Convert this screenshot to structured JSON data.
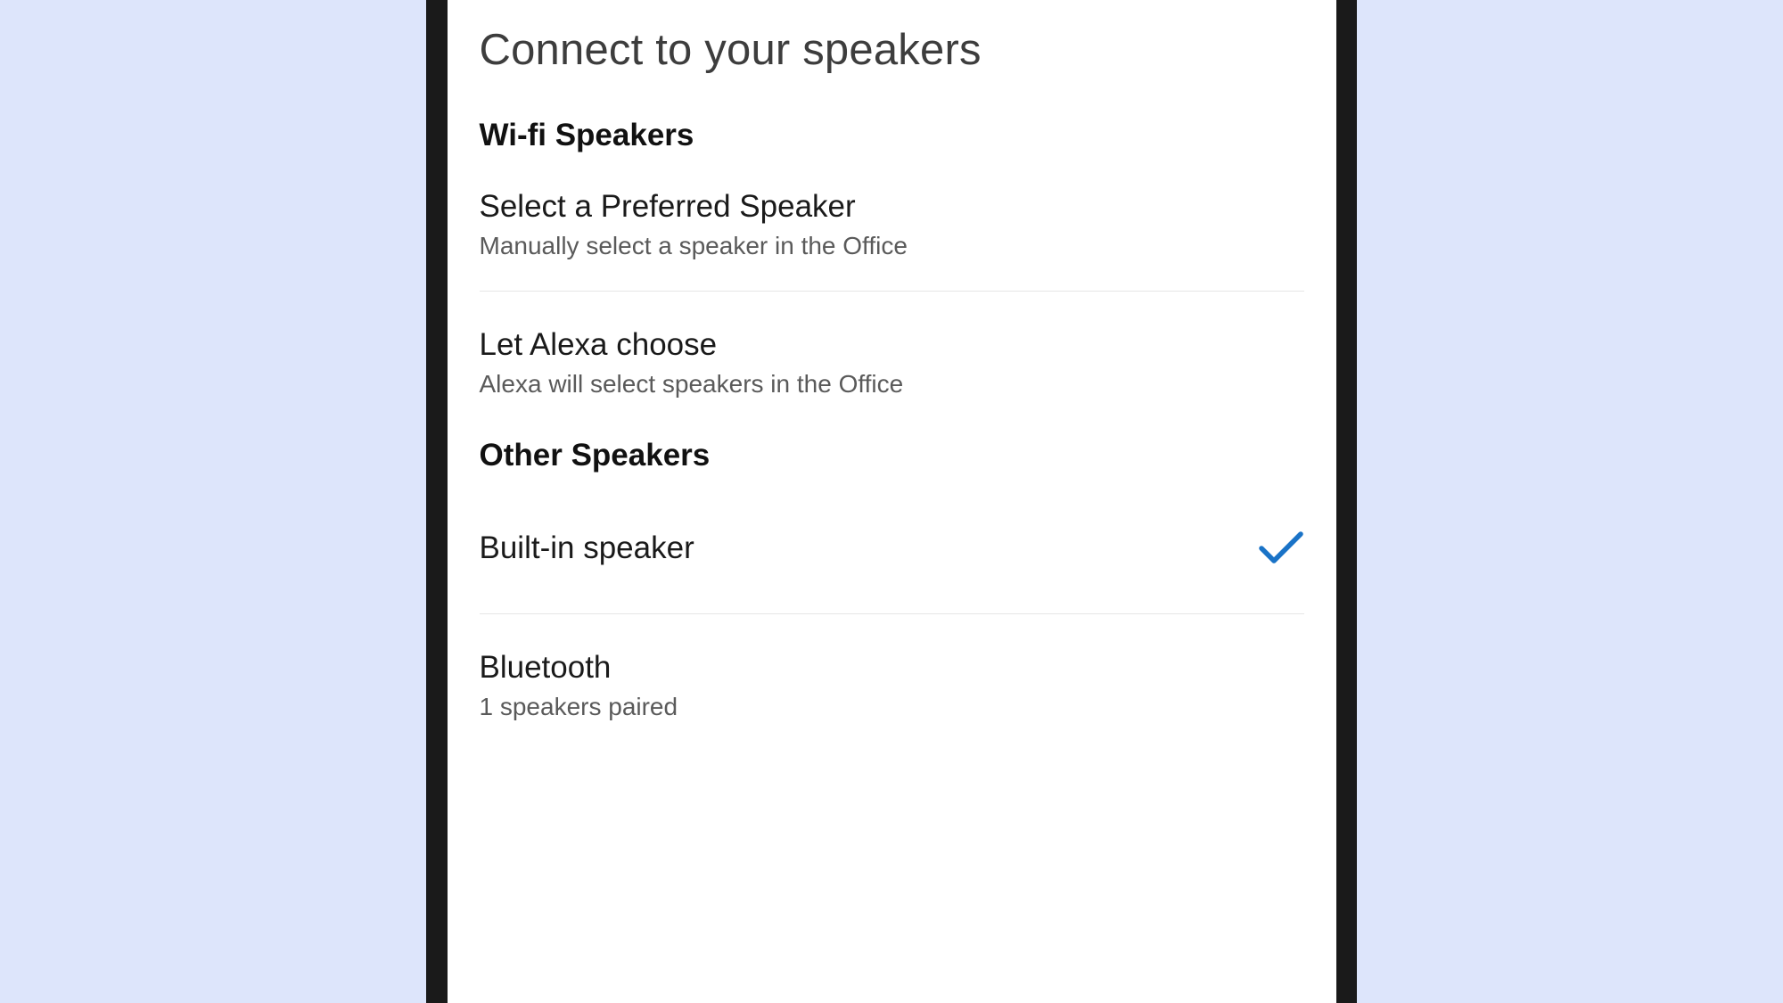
{
  "page": {
    "title": "Connect to your speakers"
  },
  "sections": {
    "wifi": {
      "heading": "Wi-fi Speakers",
      "preferred": {
        "title": "Select a Preferred Speaker",
        "subtitle": "Manually select a speaker in the Office"
      },
      "alexa": {
        "title": "Let Alexa choose",
        "subtitle": "Alexa will select speakers in the Office"
      }
    },
    "other": {
      "heading": "Other Speakers",
      "builtin": {
        "title": "Built-in speaker",
        "selected": true
      },
      "bluetooth": {
        "title": "Bluetooth",
        "subtitle": "1 speakers paired"
      }
    }
  },
  "colors": {
    "accent": "#1a73c7"
  }
}
